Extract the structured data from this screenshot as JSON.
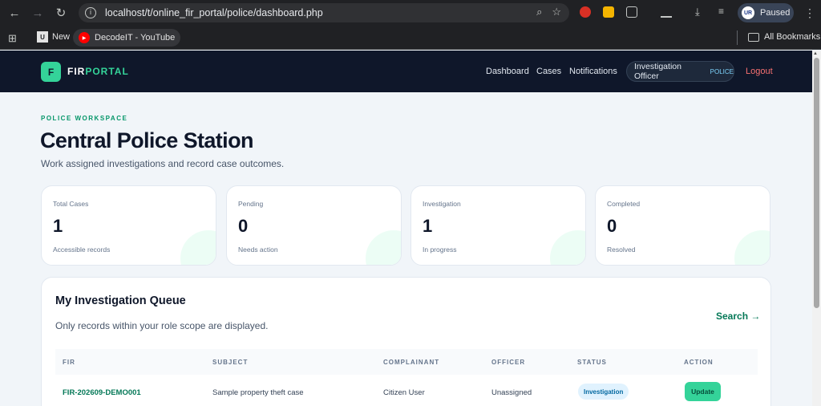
{
  "browser": {
    "url": "localhost/t/online_fir_portal/police/dashboard.php",
    "profile_status": "Paused",
    "bookmarks": [
      {
        "label": "New"
      },
      {
        "label": "DecodeIT - YouTube"
      }
    ],
    "all_bookmarks": "All Bookmarks"
  },
  "header": {
    "logo_letter": "F",
    "logo_part1": "FIR",
    "logo_part2": "PORTAL",
    "nav": [
      "Dashboard",
      "Cases",
      "Notifications"
    ],
    "role_name": "Investigation Officer",
    "role_tag": "POLICE",
    "logout": "Logout"
  },
  "page": {
    "eyebrow": "POLICE WORKSPACE",
    "title": "Central Police Station",
    "subtitle": "Work assigned investigations and record case outcomes."
  },
  "stats": [
    {
      "label": "Total Cases",
      "value": "1",
      "note": "Accessible records"
    },
    {
      "label": "Pending",
      "value": "0",
      "note": "Needs action"
    },
    {
      "label": "Investigation",
      "value": "1",
      "note": "In progress"
    },
    {
      "label": "Completed",
      "value": "0",
      "note": "Resolved"
    }
  ],
  "queue": {
    "title": "My Investigation Queue",
    "subtitle": "Only records within your role scope are displayed.",
    "search_link": "Search →",
    "columns": [
      "FIR",
      "SUBJECT",
      "COMPLAINANT",
      "OFFICER",
      "STATUS",
      "ACTION"
    ],
    "rows": [
      {
        "fir": "FIR-202609-DEMO001",
        "subject": "Sample property theft case",
        "complainant": "Citizen User",
        "officer": "Unassigned",
        "status": "Investigation",
        "action": "Update"
      }
    ]
  },
  "colors": {
    "accent": "#34d399",
    "header_bg": "#0f172a",
    "logout": "#f87171",
    "fir_link": "#047857"
  }
}
